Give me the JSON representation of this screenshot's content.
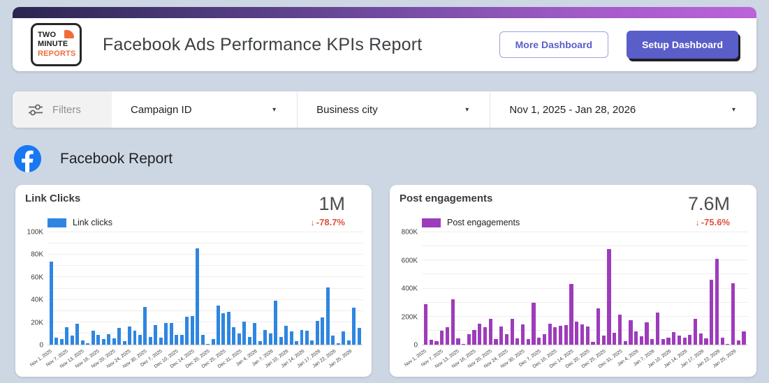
{
  "header": {
    "logo_lines": [
      "TWO",
      "MINUTE",
      "REPORTS"
    ],
    "title": "Facebook Ads Performance KPIs Report",
    "more_button": "More Dashboard",
    "setup_button": "Setup Dashboard"
  },
  "filters": {
    "label": "Filters",
    "campaign_dropdown": "Campaign ID",
    "city_dropdown": "Business city",
    "date_range": "Nov 1, 2025 - Jan 28, 2026",
    "caret": "▾"
  },
  "section": {
    "title": "Facebook Report"
  },
  "colors": {
    "accent_purple": "#5a5ec8",
    "delta_red": "#e0503c",
    "facebook_blue": "#1877f2",
    "logo_orange": "#f26b3a",
    "gradient_start": "#2b2550",
    "gradient_end": "#bb64d8"
  },
  "chart_data": [
    {
      "type": "bar",
      "title": "Link Clicks",
      "kpi_value": "1M",
      "kpi_delta": "-78.7%",
      "delta_arrow": "↓",
      "legend": "Link clicks",
      "color": "#2f86e0",
      "y_axis": {
        "max": 100000,
        "minor_step": 10000,
        "ticks": [
          {
            "value": 100000,
            "label": "100K"
          },
          {
            "value": 80000,
            "label": "80K"
          },
          {
            "value": 60000,
            "label": "60K"
          },
          {
            "value": 40000,
            "label": "40K"
          },
          {
            "value": 20000,
            "label": "20K"
          },
          {
            "value": 0,
            "label": "0"
          }
        ]
      },
      "x_tick_every": 3,
      "x_tick_labels": [
        "Nov 1, 2025",
        "Nov 7, 2025",
        "Nov 13, 2025",
        "Nov 16, 2025",
        "Nov 20, 2025",
        "Nov 24, 2025",
        "Nov 30, 2025",
        "Dec 7, 2025",
        "Dec 10, 2025",
        "Dec 14, 2025",
        "Dec 20, 2025",
        "Dec 25, 2025",
        "Dec 31, 2025",
        "Jan 4, 2026",
        "Jan 7, 2026",
        "Jan 10, 2026",
        "Jan 14, 2026",
        "Jan 17, 2026",
        "Jan 22, 2026",
        "Jan 25, 2026"
      ],
      "values": [
        74000,
        6000,
        5000,
        15500,
        8000,
        18500,
        3500,
        1000,
        12500,
        9000,
        5000,
        9500,
        5500,
        15000,
        3000,
        16000,
        12500,
        8500,
        33500,
        7000,
        17500,
        6500,
        19500,
        19500,
        9000,
        9000,
        25000,
        25500,
        86000,
        9000,
        500,
        5000,
        35000,
        28000,
        29000,
        15500,
        10000,
        20500,
        7000,
        19500,
        3000,
        13000,
        10000,
        39000,
        7000,
        17000,
        12000,
        3000,
        13000,
        12500,
        4000,
        21000,
        24500,
        51000,
        8000,
        1500,
        12000,
        4000,
        33000,
        15000
      ]
    },
    {
      "type": "bar",
      "title": "Post engagements",
      "kpi_value": "7.6M",
      "kpi_delta": "-75.6%",
      "delta_arrow": "↓",
      "legend": "Post engagements",
      "color": "#9d3cbb",
      "y_axis": {
        "max": 800000,
        "minor_step": 100000,
        "ticks": [
          {
            "value": 800000,
            "label": "800K"
          },
          {
            "value": 600000,
            "label": "600K"
          },
          {
            "value": 400000,
            "label": "400K"
          },
          {
            "value": 200000,
            "label": "200K"
          },
          {
            "value": 0,
            "label": "0"
          }
        ]
      },
      "x_tick_every": 3,
      "x_tick_labels": [
        "Nov 1, 2025",
        "Nov 7, 2025",
        "Nov 13, 2025",
        "Nov 16, 2025",
        "Nov 20, 2025",
        "Nov 24, 2025",
        "Nov 30, 2025",
        "Dec 7, 2025",
        "Dec 10, 2025",
        "Dec 14, 2025",
        "Dec 20, 2025",
        "Dec 25, 2025",
        "Dec 31, 2025",
        "Jan 4, 2026",
        "Jan 7, 2026",
        "Jan 10, 2026",
        "Jan 14, 2026",
        "Jan 17, 2026",
        "Jan 22, 2026",
        "Jan 25, 2026"
      ],
      "values": [
        290000,
        35000,
        25000,
        100000,
        125000,
        325000,
        45000,
        5000,
        75000,
        105000,
        150000,
        125000,
        185000,
        40000,
        130000,
        75000,
        185000,
        45000,
        145000,
        40000,
        300000,
        50000,
        75000,
        150000,
        125000,
        135000,
        140000,
        430000,
        165000,
        145000,
        130000,
        20000,
        260000,
        65000,
        680000,
        85000,
        215000,
        25000,
        175000,
        95000,
        60000,
        160000,
        40000,
        230000,
        40000,
        52000,
        90000,
        65000,
        52000,
        70000,
        183000,
        78000,
        45000,
        460000,
        610000,
        50000,
        5000,
        437000,
        30000,
        95000
      ]
    }
  ]
}
